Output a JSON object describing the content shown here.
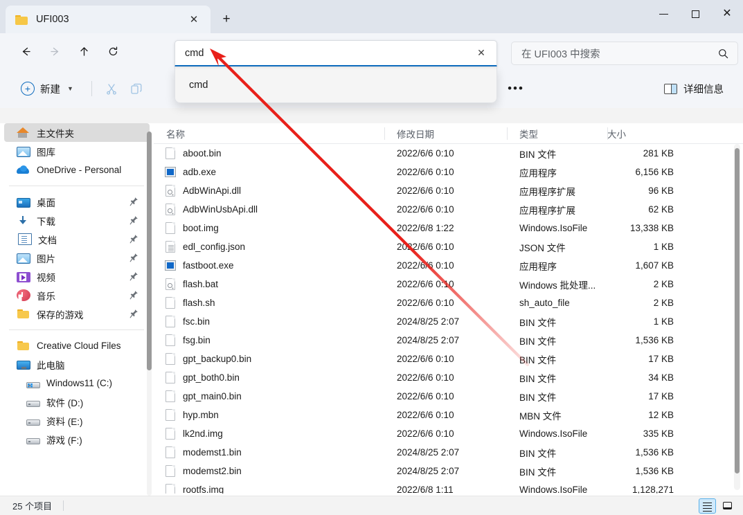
{
  "window": {
    "tab_title": "UFI003",
    "tab_close_label": "✕",
    "newtab_label": "+",
    "minimize_label": "",
    "maximize_label": "",
    "close_label": "✕"
  },
  "nav": {
    "back": "←",
    "forward": "→",
    "up": "↑",
    "refresh": "↻"
  },
  "address": {
    "value": "cmd",
    "clear_label": "✕",
    "suggestion": "cmd"
  },
  "search": {
    "placeholder": "在 UFI003 中搜索"
  },
  "toolbar": {
    "new_label": "新建",
    "new_chevron": "⌄",
    "cut_label": "",
    "copy_label": "",
    "more_label": "•••",
    "details_label": "详细信息"
  },
  "sidebar": {
    "items": [
      {
        "label": "主文件夹",
        "icon": "home-icon",
        "selected": true,
        "pinned": false,
        "indent": false
      },
      {
        "label": "图库",
        "icon": "gallery-icon",
        "selected": false,
        "pinned": false,
        "indent": false
      },
      {
        "label": "OneDrive - Personal",
        "icon": "cloud-icon",
        "selected": false,
        "pinned": false,
        "indent": false
      },
      {
        "label": "桌面",
        "icon": "desktop-icon",
        "selected": false,
        "pinned": true,
        "indent": false
      },
      {
        "label": "下载",
        "icon": "downloads-icon",
        "selected": false,
        "pinned": true,
        "indent": false
      },
      {
        "label": "文档",
        "icon": "documents-icon",
        "selected": false,
        "pinned": true,
        "indent": false
      },
      {
        "label": "图片",
        "icon": "pictures-icon",
        "selected": false,
        "pinned": true,
        "indent": false
      },
      {
        "label": "视频",
        "icon": "videos-icon",
        "selected": false,
        "pinned": true,
        "indent": false
      },
      {
        "label": "音乐",
        "icon": "music-icon",
        "selected": false,
        "pinned": true,
        "indent": false
      },
      {
        "label": "保存的游戏",
        "icon": "folder-icon",
        "selected": false,
        "pinned": true,
        "indent": false
      },
      {
        "label": "Creative Cloud Files",
        "icon": "folder-icon",
        "selected": false,
        "pinned": false,
        "indent": false
      },
      {
        "label": "此电脑",
        "icon": "this-pc-icon",
        "selected": false,
        "pinned": false,
        "indent": false
      },
      {
        "label": "Windows11 (C:)",
        "icon": "windows-drive-icon",
        "selected": false,
        "pinned": false,
        "indent": true
      },
      {
        "label": "软件 (D:)",
        "icon": "drive-icon",
        "selected": false,
        "pinned": false,
        "indent": true
      },
      {
        "label": "资料 (E:)",
        "icon": "drive-icon",
        "selected": false,
        "pinned": false,
        "indent": true
      },
      {
        "label": "游戏 (F:)",
        "icon": "drive-icon",
        "selected": false,
        "pinned": false,
        "indent": true
      }
    ],
    "separator_after": [
      2,
      9
    ]
  },
  "filelist": {
    "columns": [
      "名称",
      "修改日期",
      "类型",
      "大小"
    ],
    "rows": [
      {
        "name": "aboot.bin",
        "date": "2022/6/6 0:10",
        "type": "BIN 文件",
        "size": "281 KB",
        "icon": "blank-file-icon"
      },
      {
        "name": "adb.exe",
        "date": "2022/6/6 0:10",
        "type": "应用程序",
        "size": "6,156 KB",
        "icon": "exe-file-icon"
      },
      {
        "name": "AdbWinApi.dll",
        "date": "2022/6/6 0:10",
        "type": "应用程序扩展",
        "size": "96 KB",
        "icon": "dll-file-icon"
      },
      {
        "name": "AdbWinUsbApi.dll",
        "date": "2022/6/6 0:10",
        "type": "应用程序扩展",
        "size": "62 KB",
        "icon": "dll-file-icon"
      },
      {
        "name": "boot.img",
        "date": "2022/6/8 1:22",
        "type": "Windows.IsoFile",
        "size": "13,338 KB",
        "icon": "blank-file-icon"
      },
      {
        "name": "edl_config.json",
        "date": "2022/6/6 0:10",
        "type": "JSON 文件",
        "size": "1 KB",
        "icon": "text-file-icon"
      },
      {
        "name": "fastboot.exe",
        "date": "2022/6/6 0:10",
        "type": "应用程序",
        "size": "1,607 KB",
        "icon": "exe-file-icon"
      },
      {
        "name": "flash.bat",
        "date": "2022/6/6 0:10",
        "type": "Windows 批处理...",
        "size": "2 KB",
        "icon": "bat-file-icon"
      },
      {
        "name": "flash.sh",
        "date": "2022/6/6 0:10",
        "type": "sh_auto_file",
        "size": "2 KB",
        "icon": "blank-file-icon"
      },
      {
        "name": "fsc.bin",
        "date": "2024/8/25 2:07",
        "type": "BIN 文件",
        "size": "1 KB",
        "icon": "blank-file-icon"
      },
      {
        "name": "fsg.bin",
        "date": "2024/8/25 2:07",
        "type": "BIN 文件",
        "size": "1,536 KB",
        "icon": "blank-file-icon"
      },
      {
        "name": "gpt_backup0.bin",
        "date": "2022/6/6 0:10",
        "type": "BIN 文件",
        "size": "17 KB",
        "icon": "blank-file-icon"
      },
      {
        "name": "gpt_both0.bin",
        "date": "2022/6/6 0:10",
        "type": "BIN 文件",
        "size": "34 KB",
        "icon": "blank-file-icon"
      },
      {
        "name": "gpt_main0.bin",
        "date": "2022/6/6 0:10",
        "type": "BIN 文件",
        "size": "17 KB",
        "icon": "blank-file-icon"
      },
      {
        "name": "hyp.mbn",
        "date": "2022/6/6 0:10",
        "type": "MBN 文件",
        "size": "12 KB",
        "icon": "blank-file-icon"
      },
      {
        "name": "lk2nd.img",
        "date": "2022/6/6 0:10",
        "type": "Windows.IsoFile",
        "size": "335 KB",
        "icon": "blank-file-icon"
      },
      {
        "name": "modemst1.bin",
        "date": "2024/8/25 2:07",
        "type": "BIN 文件",
        "size": "1,536 KB",
        "icon": "blank-file-icon"
      },
      {
        "name": "modemst2.bin",
        "date": "2024/8/25 2:07",
        "type": "BIN 文件",
        "size": "1,536 KB",
        "icon": "blank-file-icon"
      },
      {
        "name": "rootfs.img",
        "date": "2022/6/8 1:11",
        "type": "Windows.IsoFile",
        "size": "1,128,271",
        "icon": "blank-file-icon"
      }
    ]
  },
  "status": {
    "item_count": "25 个项目"
  },
  "colors": {
    "accent": "#0f6cbd",
    "annotation": "#e8201a",
    "titlebar_bg": "#dfe4ec",
    "toolbar_bg": "#f3f5f9",
    "selected_bg": "#dcdcdc"
  }
}
